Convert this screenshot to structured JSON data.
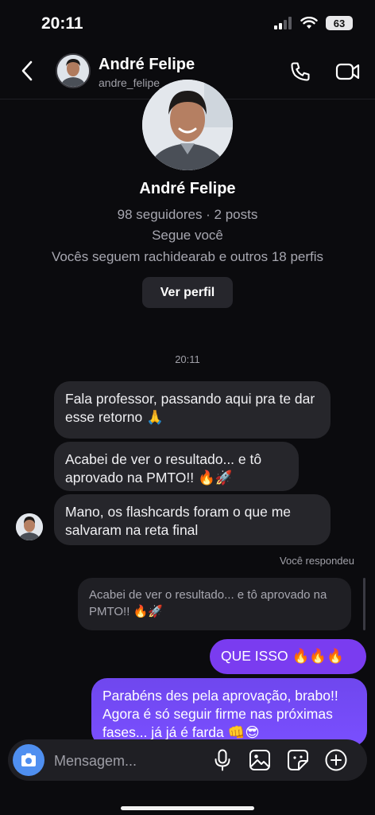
{
  "status": {
    "time": "20:11",
    "battery": "63"
  },
  "header": {
    "name": "André Felipe",
    "username": "andre_felipe_"
  },
  "profile": {
    "name": "André Felipe",
    "stats": "98 seguidores · 2 posts",
    "follows_you": "Segue você",
    "mutuals": "Vocês seguem rachidearab e outros 18 perfis",
    "view_profile": "Ver perfil"
  },
  "thread": {
    "timestamp": "20:11",
    "incoming": [
      "Fala professor, passando aqui pra te dar esse retorno 🙏",
      "Acabei de ver o resultado... e tô aprovado na PMTO!! 🔥🚀",
      "Mano, os flashcards foram o que me salvaram na reta final"
    ],
    "replied_label": "Você respondeu",
    "quoted_text": "Acabei de ver o resultado... e tô aprovado na PMTO!! 🔥🚀",
    "outgoing": [
      "QUE ISSO 🔥🔥🔥",
      "Parabéns des pela aprovação, brabo!! Agora é só seguir firme nas próximas fases... já já é farda 👊😎"
    ]
  },
  "composer": {
    "placeholder": "Mensagem..."
  },
  "colors": {
    "background": "#0b0b0e",
    "incoming_bubble": "#26262b",
    "outgoing_bubble": "#7a3cf0",
    "camera_button": "#4f8ff0"
  }
}
